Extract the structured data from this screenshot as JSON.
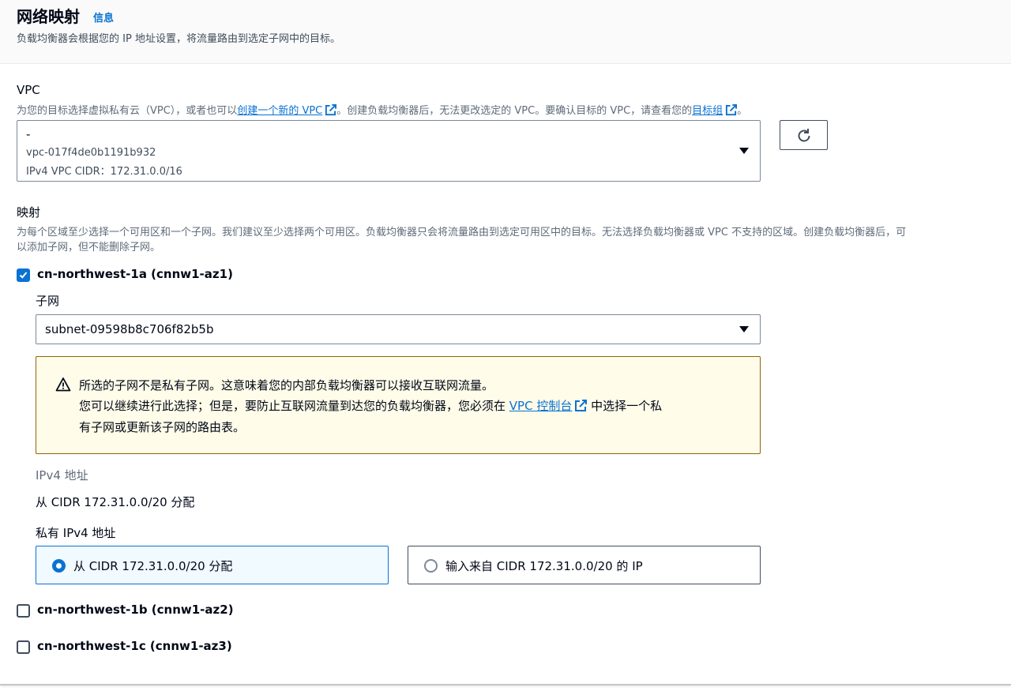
{
  "header": {
    "title": "网络映射",
    "info_link": "信息",
    "description": "负载均衡器会根据您的 IP 地址设置，将流量路由到选定子网中的目标。"
  },
  "vpc": {
    "label": "VPC",
    "desc_prefix": "为您的目标选择虚拟私有云（VPC），或者也可以",
    "create_link": "创建一个新的 VPC",
    "desc_middle": "。创建负载均衡器后，无法更改选定的 VPC。要确认目标的 VPC，请查看您的",
    "target_group_link": "目标组",
    "desc_suffix": "。",
    "selected_name": "-",
    "selected_id": "vpc-017f4de0b1191b932",
    "selected_cidr": "IPv4 VPC CIDR：172.31.0.0/16",
    "refresh_icon": "refresh-icon"
  },
  "mapping": {
    "label": "映射",
    "desc_line1": "为每个区域至少选择一个可用区和一个子网。我们建议至少选择两个可用区。负载均衡器只会将流量路由到选定可用区中的目标。无法选择负载均衡器或 VPC 不支持的区域。创建负载均衡器后，可",
    "desc_line2": "以添加子网，但不能删除子网。"
  },
  "zones": [
    {
      "label": "cn-northwest-1a (cnnw1-az1)",
      "checked": true,
      "subnet_label": "子网",
      "subnet_value": "subnet-09598b8c706f82b5b",
      "warning": {
        "icon": "warning-icon",
        "line1": "所选的子网不是私有子网。这意味着您的内部负载均衡器可以接收互联网流量。",
        "line2_prefix": "您可以继续进行此选择；但是，要防止互联网流量到达您的负载均衡器，您必须在 ",
        "line2_link": "VPC 控制台",
        "line2_suffix": " 中选择一个私",
        "line3": "有子网或更新该子网的路由表。"
      },
      "ipv4_label": "IPv4 地址",
      "ipv4_value": "从 CIDR 172.31.0.0/20 分配",
      "private_ipv4_label": "私有 IPv4 地址",
      "options": [
        {
          "label": "从 CIDR 172.31.0.0/20 分配",
          "selected": true
        },
        {
          "label": "输入来自 CIDR 172.31.0.0/20 的 IP",
          "selected": false
        }
      ]
    },
    {
      "label": "cn-northwest-1b (cnnw1-az2)",
      "checked": false
    },
    {
      "label": "cn-northwest-1c (cnnw1-az3)",
      "checked": false
    }
  ],
  "colors": {
    "link": "#0972d3",
    "warning_bg": "#fffce9",
    "warning_border": "#8d6605",
    "selected_bg": "#f1faff"
  }
}
